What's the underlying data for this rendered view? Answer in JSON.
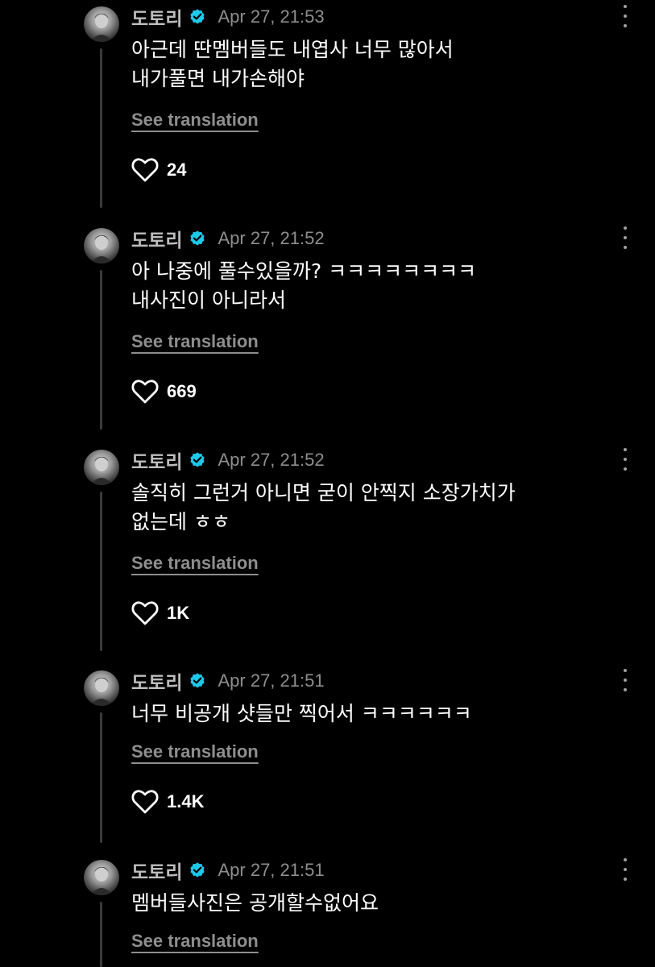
{
  "posts": [
    {
      "username": "도토리",
      "timestamp": "Apr 27, 21:53",
      "text": "아근데 딴멤버들도 내엽사 너무 많아서\n내가풀면 내가손해야",
      "translate_label": "See translation",
      "likes": "24"
    },
    {
      "username": "도토리",
      "timestamp": "Apr 27, 21:52",
      "text": "아 나중에 풀수있을까? ㅋㅋㅋㅋㅋㅋㅋㅋ\n내사진이 아니라서",
      "translate_label": "See translation",
      "likes": "669"
    },
    {
      "username": "도토리",
      "timestamp": "Apr 27, 21:52",
      "text": "솔직히 그런거 아니면 굳이 안찍지 소장가치가\n없는데 ㅎㅎ",
      "translate_label": "See translation",
      "likes": "1K"
    },
    {
      "username": "도토리",
      "timestamp": "Apr 27, 21:51",
      "text": "너무 비공개 샷들만 찍어서 ㅋㅋㅋㅋㅋㅋ",
      "translate_label": "See translation",
      "likes": "1.4K"
    },
    {
      "username": "도토리",
      "timestamp": "Apr 27, 21:51",
      "text": "멤버들사진은 공개할수없어요",
      "translate_label": "See translation",
      "likes": ""
    }
  ],
  "icons": {
    "verified": "verified-badge-icon",
    "more": "more-options-icon",
    "like": "heart-outline-icon"
  },
  "colors": {
    "background": "#000000",
    "verified": "#1ec8e8",
    "secondary_text": "#8e8e8e",
    "thread_line": "#3a3a3a"
  }
}
